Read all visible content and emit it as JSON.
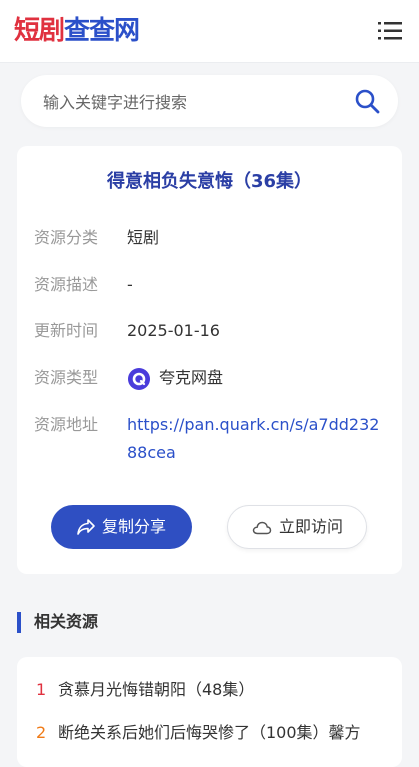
{
  "header": {
    "logo": {
      "part1": "短剧",
      "part2": "查查网"
    }
  },
  "search": {
    "placeholder": "输入关键字进行搜索",
    "value": ""
  },
  "resource": {
    "title": "得意相负失意悔（36集）",
    "category_label": "资源分类",
    "category_value": "短剧",
    "description_label": "资源描述",
    "description_value": "-",
    "updated_label": "更新时间",
    "updated_value": "2025-01-16",
    "type_label": "资源类型",
    "type_value": "夸克网盘",
    "address_label": "资源地址",
    "address_value": "https://pan.quark.cn/s/a7dd23288cea"
  },
  "actions": {
    "copy_label": "复制分享",
    "visit_label": "立即访问"
  },
  "related": {
    "title": "相关资源",
    "items": [
      {
        "num": "1",
        "text": "贪慕月光悔错朝阳（48集）"
      },
      {
        "num": "2",
        "text": "断绝关系后她们后悔哭惨了（100集）馨方"
      }
    ]
  },
  "colors": {
    "brand_blue": "#2b50c9",
    "brand_red": "#e0313f",
    "rank1": "#e0313f",
    "rank2": "#f07a16"
  },
  "icons": {
    "menu": "menu-icon",
    "search": "search-icon",
    "quark": "quark-icon",
    "share": "share-icon",
    "cloud": "cloud-icon"
  }
}
